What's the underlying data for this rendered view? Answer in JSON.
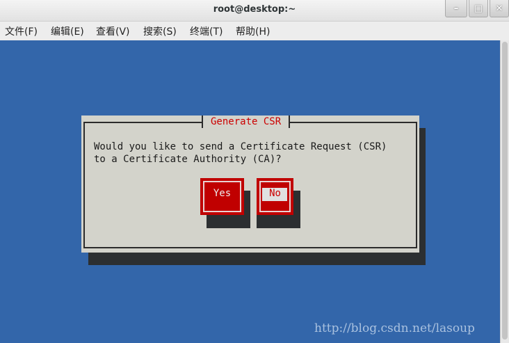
{
  "window": {
    "title": "root@desktop:~",
    "controls": [
      "minimize-icon",
      "maximize-icon",
      "close-icon"
    ]
  },
  "menubar": {
    "items": [
      "文件(F)",
      "编辑(E)",
      "查看(V)",
      "搜索(S)",
      "终端(T)",
      "帮助(H)"
    ]
  },
  "dialog": {
    "title": "Generate CSR",
    "message_line1": "Would you like to send a Certificate Request (CSR)",
    "message_line2": "to a Certificate Authority (CA)?",
    "yes_label": "Yes",
    "no_label": "No",
    "selected": "No"
  },
  "watermark": "http://blog.csdn.net/lasoup",
  "colors": {
    "terminal_bg": "#3366aa",
    "dialog_bg": "#d3d3cb",
    "button_red": "#c00000",
    "title_red": "#cc0000"
  }
}
